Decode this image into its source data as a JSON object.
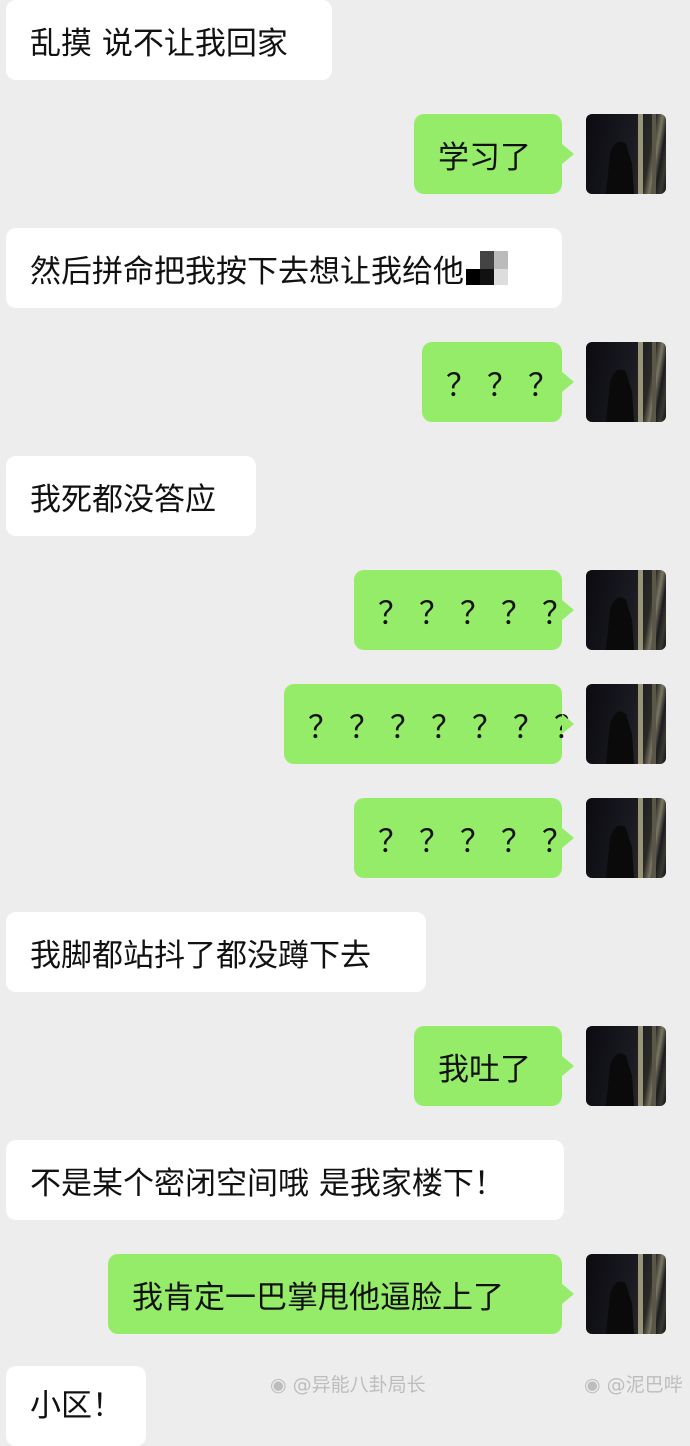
{
  "messages": [
    {
      "side": "left",
      "text": "乱摸 说不让我回家"
    },
    {
      "side": "right",
      "text": "学习了"
    },
    {
      "side": "left",
      "text": "然后拼命把我按下去想让我给他"
    },
    {
      "side": "right",
      "text": "？？？"
    },
    {
      "side": "left",
      "text": "我死都没答应"
    },
    {
      "side": "right",
      "text": "？？？？？"
    },
    {
      "side": "right",
      "text": "？？？？？？？"
    },
    {
      "side": "right",
      "text": "？？？？？"
    },
    {
      "side": "left",
      "text": "我脚都站抖了都没蹲下去"
    },
    {
      "side": "right",
      "text": "我吐了"
    },
    {
      "side": "left",
      "text": "不是某个密闭空间哦 是我家楼下！"
    },
    {
      "side": "right",
      "text": "我肯定一巴掌甩他逼脸上了"
    },
    {
      "side": "left",
      "text": "小区！"
    }
  ],
  "watermarks": [
    "@异能八卦局长",
    "@泥巴哔"
  ],
  "colors": {
    "background": "#ededed",
    "left_bubble": "#ffffff",
    "right_bubble": "#95ec69"
  }
}
